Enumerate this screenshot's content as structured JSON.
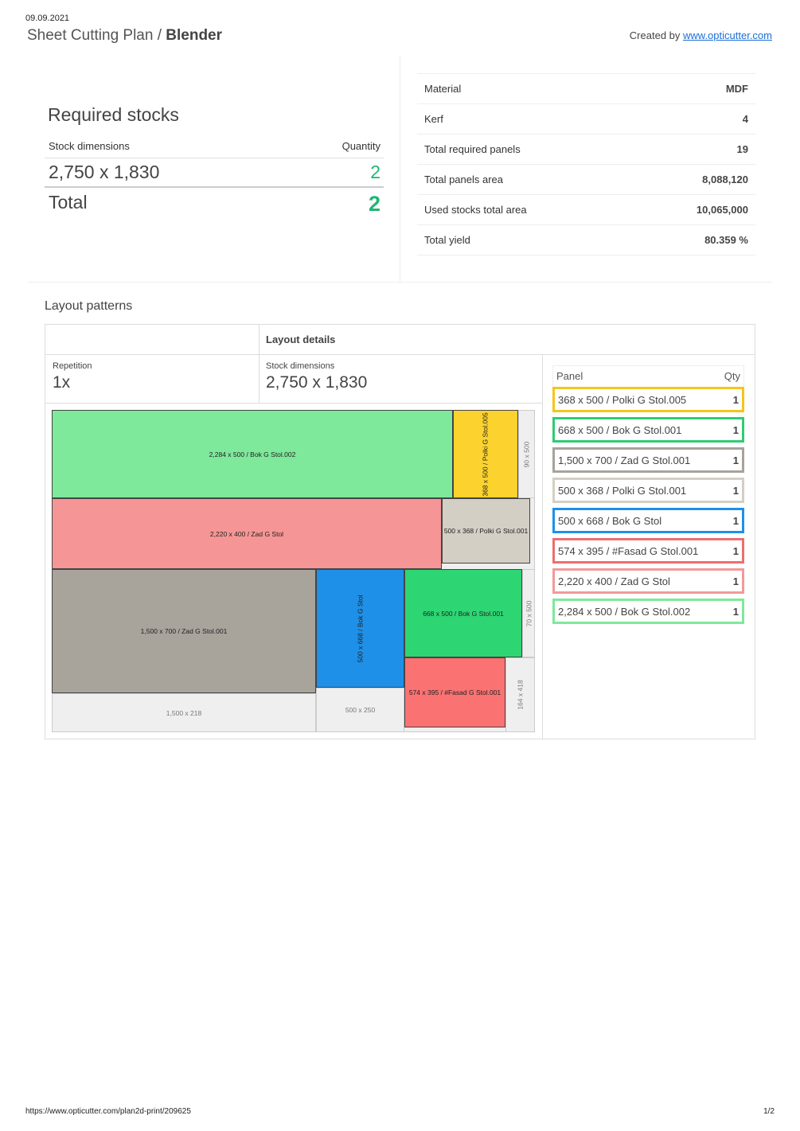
{
  "header": {
    "date": "09.09.2021",
    "title_prefix": "Sheet Cutting Plan / ",
    "title_name": "Blender",
    "created_by": "Created by ",
    "created_link": "www.opticutter.com"
  },
  "required_stocks": {
    "title": "Required stocks",
    "col_dimensions": "Stock dimensions",
    "col_quantity": "Quantity",
    "rows": [
      {
        "dimensions": "2,750 x 1,830",
        "quantity": "2"
      }
    ],
    "total_label": "Total",
    "total_value": "2"
  },
  "summary": [
    {
      "label": "Material",
      "value": "MDF"
    },
    {
      "label": "Kerf",
      "value": "4"
    },
    {
      "label": "Total required panels",
      "value": "19"
    },
    {
      "label": "Total panels area",
      "value": "8,088,120"
    },
    {
      "label": "Used stocks total area",
      "value": "10,065,000"
    },
    {
      "label": "Total yield",
      "value": "80.359 %"
    }
  ],
  "layout": {
    "title": "Layout patterns",
    "details_label": "Layout details",
    "repetition_label": "Repetition",
    "repetition_value": "1x",
    "stock_dim_label": "Stock dimensions",
    "stock_dim_value": "2,750 x 1,830",
    "panel_col": "Panel",
    "qty_col": "Qty",
    "panels": [
      {
        "label": "368 x 500 / Polki G Stol.005",
        "qty": "1",
        "color": "#f5c518"
      },
      {
        "label": "668 x 500 / Bok G Stol.001",
        "qty": "1",
        "color": "#2ecc71"
      },
      {
        "label": "1,500 x 700 / Zad G Stol.001",
        "qty": "1",
        "color": "#a8a39b"
      },
      {
        "label": "500 x 368 / Polki G Stol.001",
        "qty": "1",
        "color": "#d4cfc4"
      },
      {
        "label": "500 x 668 / Bok G Stol",
        "qty": "1",
        "color": "#1e90e8"
      },
      {
        "label": "574 x 395 / #Fasad G Stol.001",
        "qty": "1",
        "color": "#ec6f6f"
      },
      {
        "label": "2,220 x 400 / Zad G Stol",
        "qty": "1",
        "color": "#f29a9a"
      },
      {
        "label": "2,284 x 500 / Bok G Stol.002",
        "qty": "1",
        "color": "#7ee89b"
      }
    ],
    "pieces": {
      "p1": "2,284 x 500 / Bok G Stol.002",
      "p2": "368 x 500 / Polki G Stol.005",
      "w1": "90 x 500",
      "p3": "2,220 x 400 / Zad G Stol",
      "p4": "500 x 368 / Polki G Stol.001",
      "p5": "1,500 x 700 / Zad G Stol.001",
      "p6": "500 x 668 / Bok G Stol",
      "p7": "668 x 500 / Bok G Stol.001",
      "w2": "70 x 500",
      "p8": "574 x 395 / #Fasad G Stol.001",
      "w3": "164 x 418",
      "w4": "1,500 x 218",
      "w5": "500 x 250"
    }
  },
  "footer": {
    "url": "https://www.opticutter.com/plan2d-print/209625",
    "page": "1/2"
  }
}
